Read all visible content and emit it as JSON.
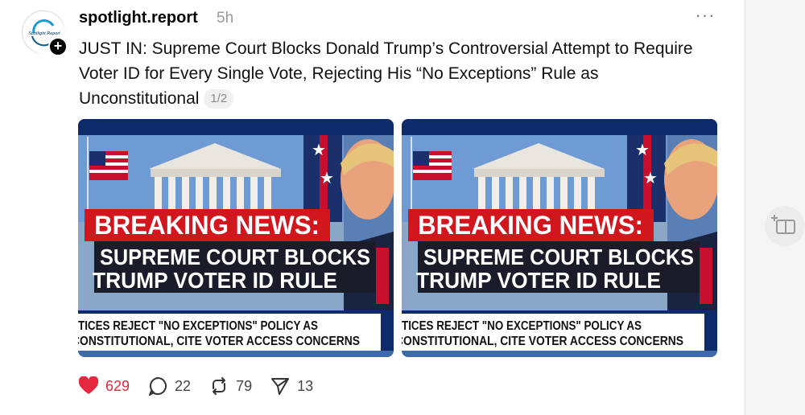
{
  "post": {
    "username": "spotlight.report",
    "timestamp": "5h",
    "avatar_text": "Spotlight Report",
    "body_text": "JUST IN: Supreme Court Blocks Donald Trump’s Controversial Attempt to Require Voter ID for Every Single Vote, Rejecting His “No Exceptions” Rule as Unconstitutional",
    "page_indicator": "1/2"
  },
  "media": [
    {
      "banner_red": "BREAKING NEWS:",
      "headline_line1": "SUPREME COURT BLOCKS",
      "headline_line2": "TRUMP VOTER ID RULE",
      "ticker_line1": "TICES REJECT \"NO EXCEPTIONS\" POLICY AS",
      "ticker_line2": "CONSTITUTIONAL, CITE VOTER ACCESS CONCERNS"
    },
    {
      "banner_red": "BREAKING NEWS:",
      "headline_line1": "SUPREME COURT BLOCKS",
      "headline_line2": "TRUMP VOTER ID RULE",
      "ticker_line1": "TICES REJECT \"NO EXCEPTIONS\" POLICY AS",
      "ticker_line2": "CONSTITUTIONAL, CITE VOTER ACCESS CONCERNS"
    }
  ],
  "actions": {
    "likes": "629",
    "replies": "22",
    "reposts": "79",
    "shares": "13"
  },
  "icons": {
    "like": "heart-icon",
    "reply": "comment-icon",
    "repost": "repost-icon",
    "share": "send-icon",
    "more": "more-icon",
    "rail": "columns-add-icon"
  },
  "colors": {
    "like": "#e5283d",
    "banner_red": "#d1161d",
    "navy": "#0d2a6b"
  }
}
